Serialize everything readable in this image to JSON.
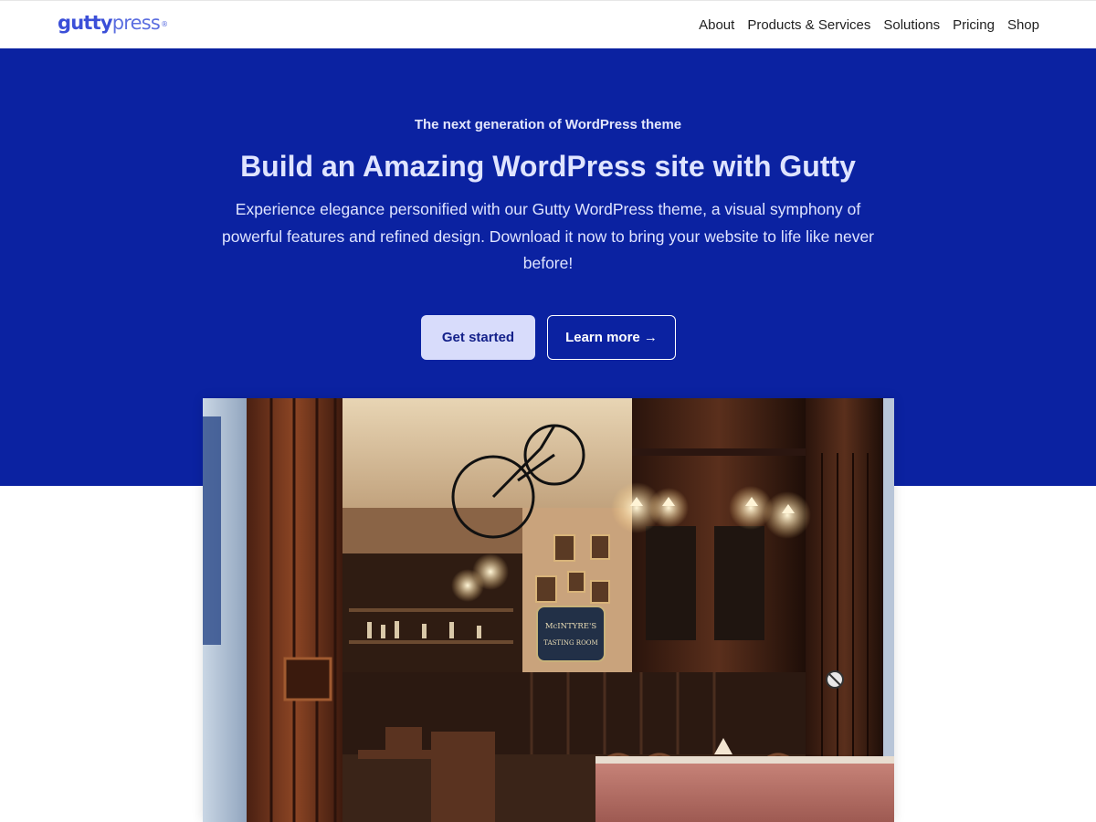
{
  "header": {
    "logo_bold": "gutty",
    "logo_light": "press",
    "logo_mark": "®",
    "nav": [
      "About",
      "Products & Services",
      "Solutions",
      "Pricing",
      "Shop"
    ]
  },
  "hero": {
    "eyebrow": "The next generation of WordPress theme",
    "title": "Build an Amazing WordPress site with Gutty",
    "description": "Experience elegance personified with our Gutty WordPress theme, a visual symphony of powerful features and refined design. Download it now to bring your website to life like never before!",
    "primary_button": "Get started",
    "secondary_button": "Learn more →",
    "image_alt": "Restaurant interior with a bicycle hanging from the ceiling",
    "sign_text_1": "McINTYRE'S",
    "sign_text_2": "TASTING ROOM"
  },
  "colors": {
    "hero_background": "#0b22a1",
    "brand": "#3b4fd8",
    "primary_button_bg": "#d8dcfb"
  }
}
